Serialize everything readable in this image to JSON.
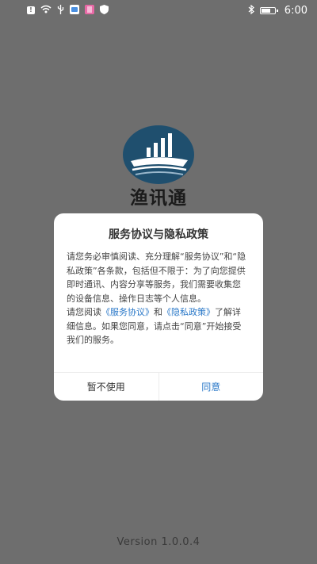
{
  "status_bar": {
    "time": "6:00",
    "left_icons": [
      "alert-icon",
      "wifi-icon",
      "usb-icon",
      "app-icon-blue",
      "app-icon-pink",
      "shield-icon"
    ],
    "right_icons": [
      "bluetooth-icon",
      "battery-icon"
    ]
  },
  "app": {
    "name": "渔讯通",
    "logo_icon": "ship-signal-logo",
    "logo_color": "#1f4f6e"
  },
  "dialog": {
    "title": "服务协议与隐私政策",
    "para1": "请您务必审慎阅读、充分理解“服务协议”和“隐私政策”各条款，包括但不限于：为了向您提供即时通讯、内容分享等服务，我们需要收集您的设备信息、操作日志等个人信息。",
    "read_prefix": "请您阅读",
    "service_link": "《服务协议》",
    "and_text": "和",
    "privacy_link": "《隐私政策》",
    "para2_tail": "了解详细信息。如果您同意，请点击“同意”开始接受我们的服务。",
    "decline_label": "暂不使用",
    "agree_label": "同意",
    "link_color": "#2a78c8"
  },
  "version": "Version 1.0.0.4"
}
